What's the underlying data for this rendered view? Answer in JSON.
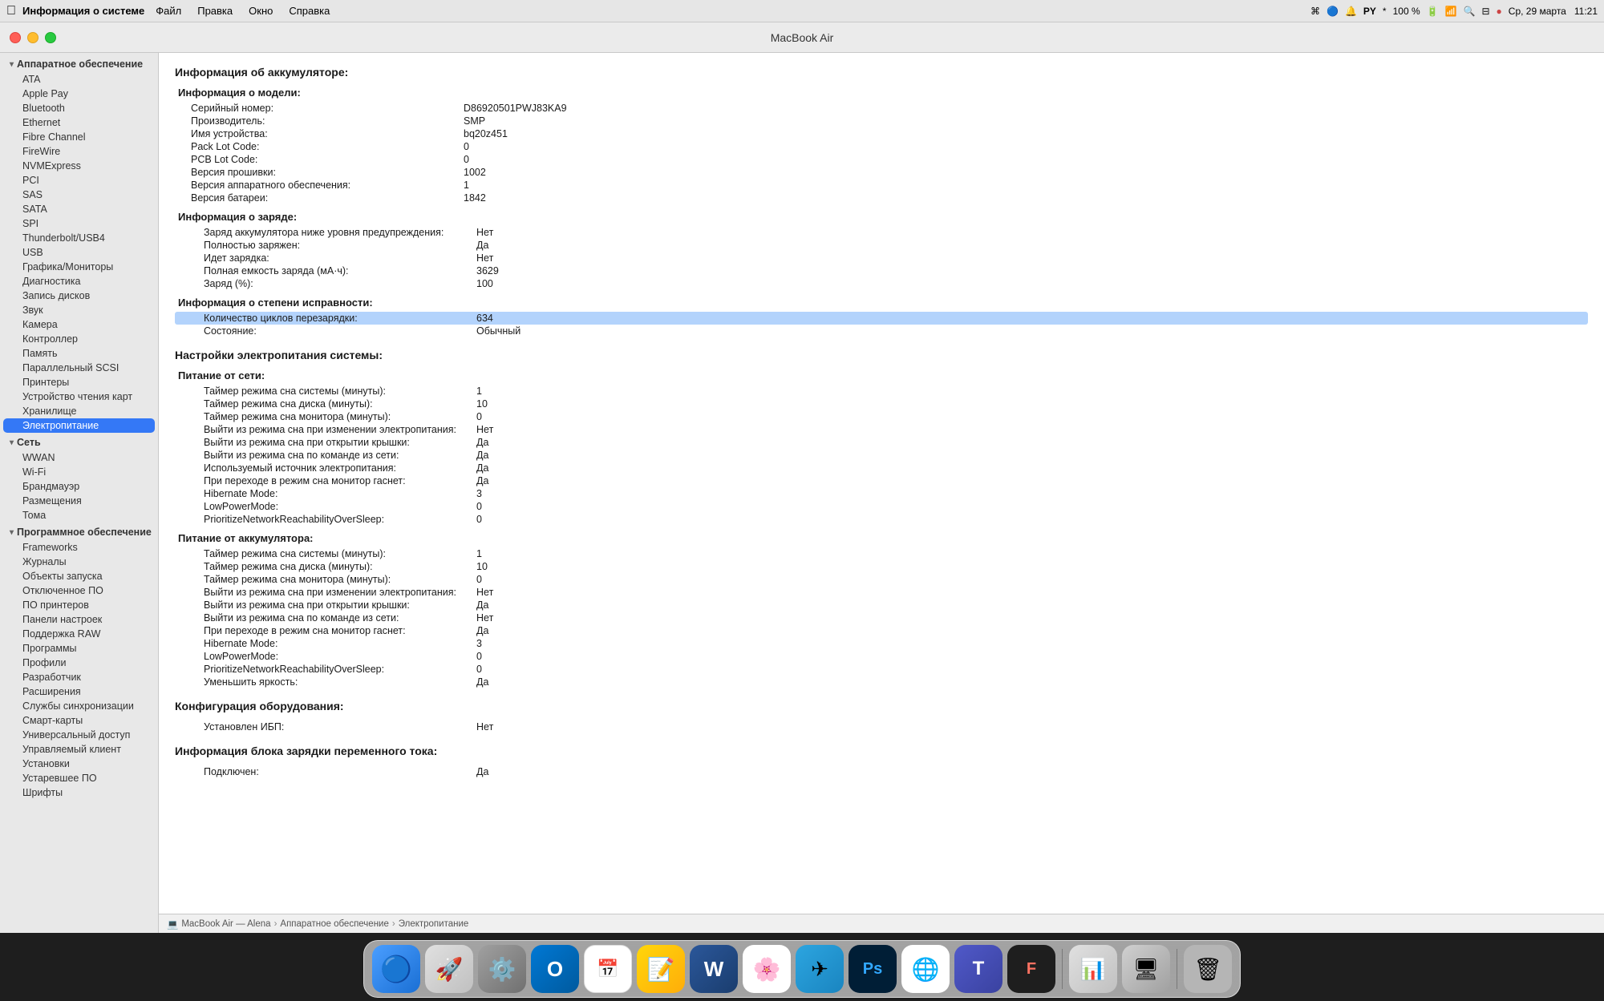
{
  "menubar": {
    "apple": "⌘",
    "app_name": "Информация о системе",
    "menus": [
      "Файл",
      "Правка",
      "Окно",
      "Справка"
    ],
    "right_items": [
      "100 %",
      "🔋",
      "Ср, 29 марта",
      "11:21"
    ]
  },
  "window": {
    "title": "MacBook Air",
    "breadcrumb": {
      "icon": "💻",
      "parts": [
        "MacBook Air — Alena",
        "Аппаратное обеспечение",
        "Электропитание"
      ]
    }
  },
  "sidebar": {
    "hardware_group": "Аппаратное обеспечение",
    "hardware_items": [
      "ATA",
      "Apple Pay",
      "Bluetooth",
      "Ethernet",
      "Fibre Channel",
      "FireWire",
      "NVMExpress",
      "PCI",
      "SAS",
      "SATA",
      "SPI",
      "Thunderbolt/USB4",
      "USB",
      "Графика/Мониторы",
      "Диагностика",
      "Запись дисков",
      "Звук",
      "Камера",
      "Контроллер",
      "Память",
      "Параллельный SCSI",
      "Принтеры",
      "Устройство чтения карт",
      "Хранилище",
      "Электропитание"
    ],
    "network_group": "Сеть",
    "network_items": [
      "WWAN",
      "Wi-Fi",
      "Брандмауэр",
      "Размещения",
      "Тома"
    ],
    "software_group": "Программное обеспечение",
    "software_items": [
      "Frameworks",
      "Журналы",
      "Объекты запуска",
      "Отключенное ПО",
      "ПО принтеров",
      "Панели настроек",
      "Поддержка RAW",
      "Программы",
      "Профили",
      "Разработчик",
      "Расширения",
      "Службы синхронизации",
      "Смарт-карты",
      "Универсальный доступ",
      "Управляемый клиент",
      "Установки",
      "Устаревшее ПО",
      "Шрифты"
    ]
  },
  "main": {
    "page_title": "Информация об аккумуляторе:",
    "model_section_title": "Информация о модели:",
    "model_rows": [
      {
        "label": "Серийный номер:",
        "value": "D86920501PWJ83KA9"
      },
      {
        "label": "Производитель:",
        "value": "SMP"
      },
      {
        "label": "Имя устройства:",
        "value": "bq20z451"
      },
      {
        "label": "Pack Lot Code:",
        "value": "0"
      },
      {
        "label": "PCB Lot Code:",
        "value": "0"
      },
      {
        "label": "Версия прошивки:",
        "value": "1002"
      },
      {
        "label": "Версия аппаратного обеспечения:",
        "value": "1"
      },
      {
        "label": "Версия батареи:",
        "value": "1842"
      }
    ],
    "charge_section_title": "Информация о заряде:",
    "charge_rows": [
      {
        "label": "Заряд аккумулятора ниже уровня предупреждения:",
        "value": "Нет"
      },
      {
        "label": "Полностью заряжен:",
        "value": "Да"
      },
      {
        "label": "Идет зарядка:",
        "value": "Нет"
      },
      {
        "label": "Полная емкость заряда (мА·ч):",
        "value": "3629"
      },
      {
        "label": "Заряд (%):",
        "value": "100"
      }
    ],
    "health_section_title": "Информация о степени исправности:",
    "health_rows": [
      {
        "label": "Количество циклов перезарядки:",
        "value": "634",
        "highlighted": true
      },
      {
        "label": "Состояние:",
        "value": "Обычный"
      }
    ],
    "power_section_title": "Настройки электропитания системы:",
    "power_network_title": "Питание от сети:",
    "power_network_rows": [
      {
        "label": "Таймер режима сна системы (минуты):",
        "value": "1"
      },
      {
        "label": "Таймер режима сна диска (минуты):",
        "value": "10"
      },
      {
        "label": "Таймер режима сна монитора (минуты):",
        "value": "0"
      },
      {
        "label": "Выйти из режима сна при изменении электропитания:",
        "value": "Нет"
      },
      {
        "label": "Выйти из режима сна при открытии крышки:",
        "value": "Да"
      },
      {
        "label": "Выйти из режима сна по команде из сети:",
        "value": "Да"
      },
      {
        "label": "Используемый источник электропитания:",
        "value": "Да"
      },
      {
        "label": "При переходе в режим сна монитор гаснет:",
        "value": "Да"
      },
      {
        "label": "Hibernate Mode:",
        "value": "3"
      },
      {
        "label": "LowPowerMode:",
        "value": "0"
      },
      {
        "label": "PrioritizeNetworkReachabilityOverSleep:",
        "value": "0"
      }
    ],
    "power_battery_title": "Питание от аккумулятора:",
    "power_battery_rows": [
      {
        "label": "Таймер режима сна системы (минуты):",
        "value": "1"
      },
      {
        "label": "Таймер режима сна диска (минуты):",
        "value": "10"
      },
      {
        "label": "Таймер режима сна монитора (минуты):",
        "value": "0"
      },
      {
        "label": "Выйти из режима сна при изменении электропитания:",
        "value": "Нет"
      },
      {
        "label": "Выйти из режима сна при открытии крышки:",
        "value": "Да"
      },
      {
        "label": "Выйти из режима сна по команде из сети:",
        "value": "Нет"
      },
      {
        "label": "При переходе в режим сна монитор гаснет:",
        "value": "Да"
      },
      {
        "label": "Hibernate Mode:",
        "value": "3"
      },
      {
        "label": "LowPowerMode:",
        "value": "0"
      },
      {
        "label": "PrioritizeNetworkReachabilityOverSleep:",
        "value": "0"
      },
      {
        "label": "Уменьшить яркость:",
        "value": "Да"
      }
    ],
    "hardware_config_title": "Конфигурация оборудования:",
    "hardware_config_rows": [
      {
        "label": "Установлен ИБП:",
        "value": "Нет"
      }
    ],
    "ac_info_title": "Информация блока зарядки переменного тока:",
    "ac_rows": [
      {
        "label": "Подключен:",
        "value": "Да"
      }
    ]
  },
  "dock": {
    "icons": [
      {
        "name": "finder",
        "label": "Finder",
        "color": "#4a9eff",
        "char": "🔵"
      },
      {
        "name": "launchpad",
        "label": "Launchpad",
        "color": "#e8e8e8",
        "char": "🚀"
      },
      {
        "name": "system-prefs",
        "label": "System Preferences",
        "color": "#888",
        "char": "⚙️"
      },
      {
        "name": "outlook",
        "label": "Outlook",
        "color": "#0078d4",
        "char": "📧"
      },
      {
        "name": "calendar",
        "label": "Calendar",
        "color": "#ff3b30",
        "char": "📅"
      },
      {
        "name": "notes",
        "label": "Notes",
        "color": "#ffd60a",
        "char": "📝"
      },
      {
        "name": "word",
        "label": "Word",
        "color": "#2b579a",
        "char": "W"
      },
      {
        "name": "photos",
        "label": "Photos",
        "color": "#ff9500",
        "char": "🖼"
      },
      {
        "name": "telegram",
        "label": "Telegram",
        "color": "#2ca5e0",
        "char": "✈"
      },
      {
        "name": "photoshop",
        "label": "Photoshop",
        "color": "#001e36",
        "char": "Ps"
      },
      {
        "name": "chrome",
        "label": "Chrome",
        "color": "#4285f4",
        "char": "🌐"
      },
      {
        "name": "teams",
        "label": "Teams",
        "color": "#5059c9",
        "char": "T"
      },
      {
        "name": "figma",
        "label": "Figma",
        "color": "#1e1e1e",
        "char": "F"
      },
      {
        "name": "activity-monitor",
        "label": "Activity Monitor",
        "color": "#888",
        "char": "📊"
      },
      {
        "name": "sysinfo",
        "label": "System Info",
        "color": "#666",
        "char": "ℹ"
      },
      {
        "name": "trash",
        "label": "Trash",
        "color": "#aaa",
        "char": "🗑"
      }
    ]
  }
}
